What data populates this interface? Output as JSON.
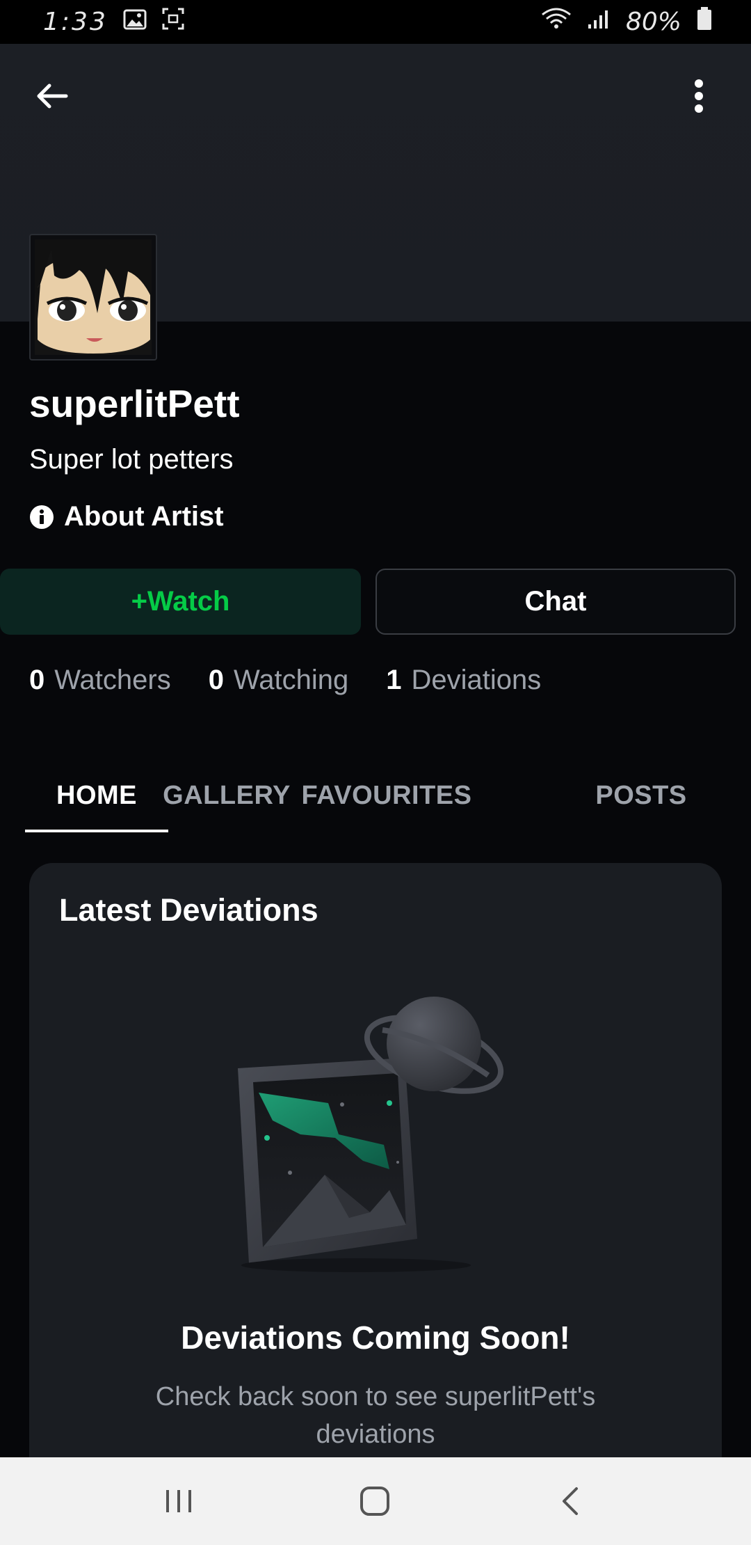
{
  "status_bar": {
    "time": "1:33",
    "battery": "80%"
  },
  "profile": {
    "username": "superlitPett",
    "tagline": "Super lot petters",
    "about_label": "About Artist"
  },
  "actions": {
    "watch_label": "+Watch",
    "chat_label": "Chat"
  },
  "stats": [
    {
      "count": "0",
      "label": "Watchers"
    },
    {
      "count": "0",
      "label": "Watching"
    },
    {
      "count": "1",
      "label": "Deviations"
    }
  ],
  "tabs": [
    {
      "label": "HOME",
      "active": true
    },
    {
      "label": "GALLERY",
      "active": false
    },
    {
      "label": "FAVOURITES",
      "active": false
    },
    {
      "label": "POSTS",
      "active": false
    }
  ],
  "card": {
    "title": "Latest Deviations",
    "empty_title": "Deviations Coming Soon!",
    "empty_desc": "Check back soon to see superlitPett's deviations"
  },
  "colors": {
    "accent_green": "#05cc47",
    "watch_bg": "#0b2520",
    "background": "#06070a",
    "card_bg": "#1a1d22"
  }
}
